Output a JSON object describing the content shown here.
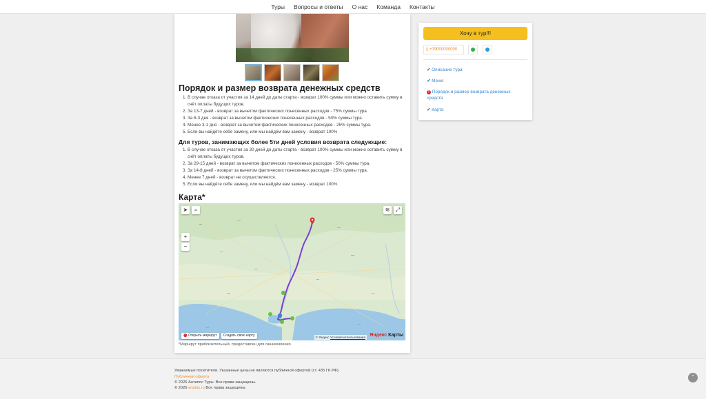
{
  "nav": {
    "items": [
      "Туры",
      "Вопросы и ответы",
      "О нас",
      "Команда",
      "Контакты"
    ]
  },
  "refund": {
    "title": "Порядок и размер возврата денежных средств",
    "items": [
      "В случае отказа от участия за 14 дней до даты старта - возврат 100% суммы или можно оставить сумму в счёт оплаты будущих туров.",
      "За 13-7 дней - возврат за вычетом фактических понесенных расходов - 75% суммы тура.",
      "За 6-3 дня - возврат за вычетом фактических понесенных расходов - 50% суммы тура.",
      "Менее 3-1 дня - возврат за вычетом фактических понесенных расходов - 25% суммы тура.",
      "Если вы найдёте себе замену, или мы найдём вам замену - возврат 100%"
    ],
    "long_title": "Для туров, занимающих более 5ти дней условия возврата следующие:",
    "long_items": [
      "В случае отказа от участия за 30 дней до даты старта - возврат 100% суммы или можно оставить сумму в счёт оплаты будущих туров.",
      "За 29-15 дней - возврат за вычетом фактических понесенных расходов - 50% суммы тура.",
      "За 14-8 дней - возврат за вычетом фактических понесенных расходов - 25% суммы тура.",
      "Менее 7 дней - возврат не осуществляется.",
      "Если вы найдёте себе замену, или мы найдём вам замену - возврат 100%"
    ]
  },
  "map": {
    "title": "Карта*",
    "open_route": "Открыть маршрут",
    "create_map": "Создать свою карту",
    "copyright": "© Яндекс",
    "terms": "Условия использования",
    "logo_ya": "Яндекс",
    "logo_rest": " Карты",
    "zoom_in": "+",
    "zoom_out": "−",
    "note": "*Маршрут приблизительный, предоставлен для ознакомления."
  },
  "sidebar": {
    "cta": "Хочу в тур!!!",
    "phone": "+79000000000",
    "links": [
      "Описание тура",
      "Меню",
      "Порядок и размер возврата денежных средств",
      "Карта"
    ],
    "colors": {
      "cta": "#f5bf1e",
      "link": "#3c86c7",
      "phone": "#f08a24"
    }
  },
  "footer": {
    "disclaimer": "Уважаемые посетители. Указанные цены не являются публичной офертой (ст. 435 ГК РФ).",
    "offer": "Публичная оферта",
    "copy1": "© 2026 Антипос Туры. Все права защищены.",
    "copy2_a": "© 2026 ",
    "copy2_link": "anptos.ru",
    "copy2_b": " Все права защищены."
  },
  "icons": [
    "location-arrow-icon",
    "search-icon",
    "layers-icon",
    "fullscreen-icon",
    "map-pin-icon",
    "whatsapp-icon",
    "telegram-icon",
    "phone-icon",
    "check-icon",
    "error-icon",
    "arrow-up-icon"
  ]
}
